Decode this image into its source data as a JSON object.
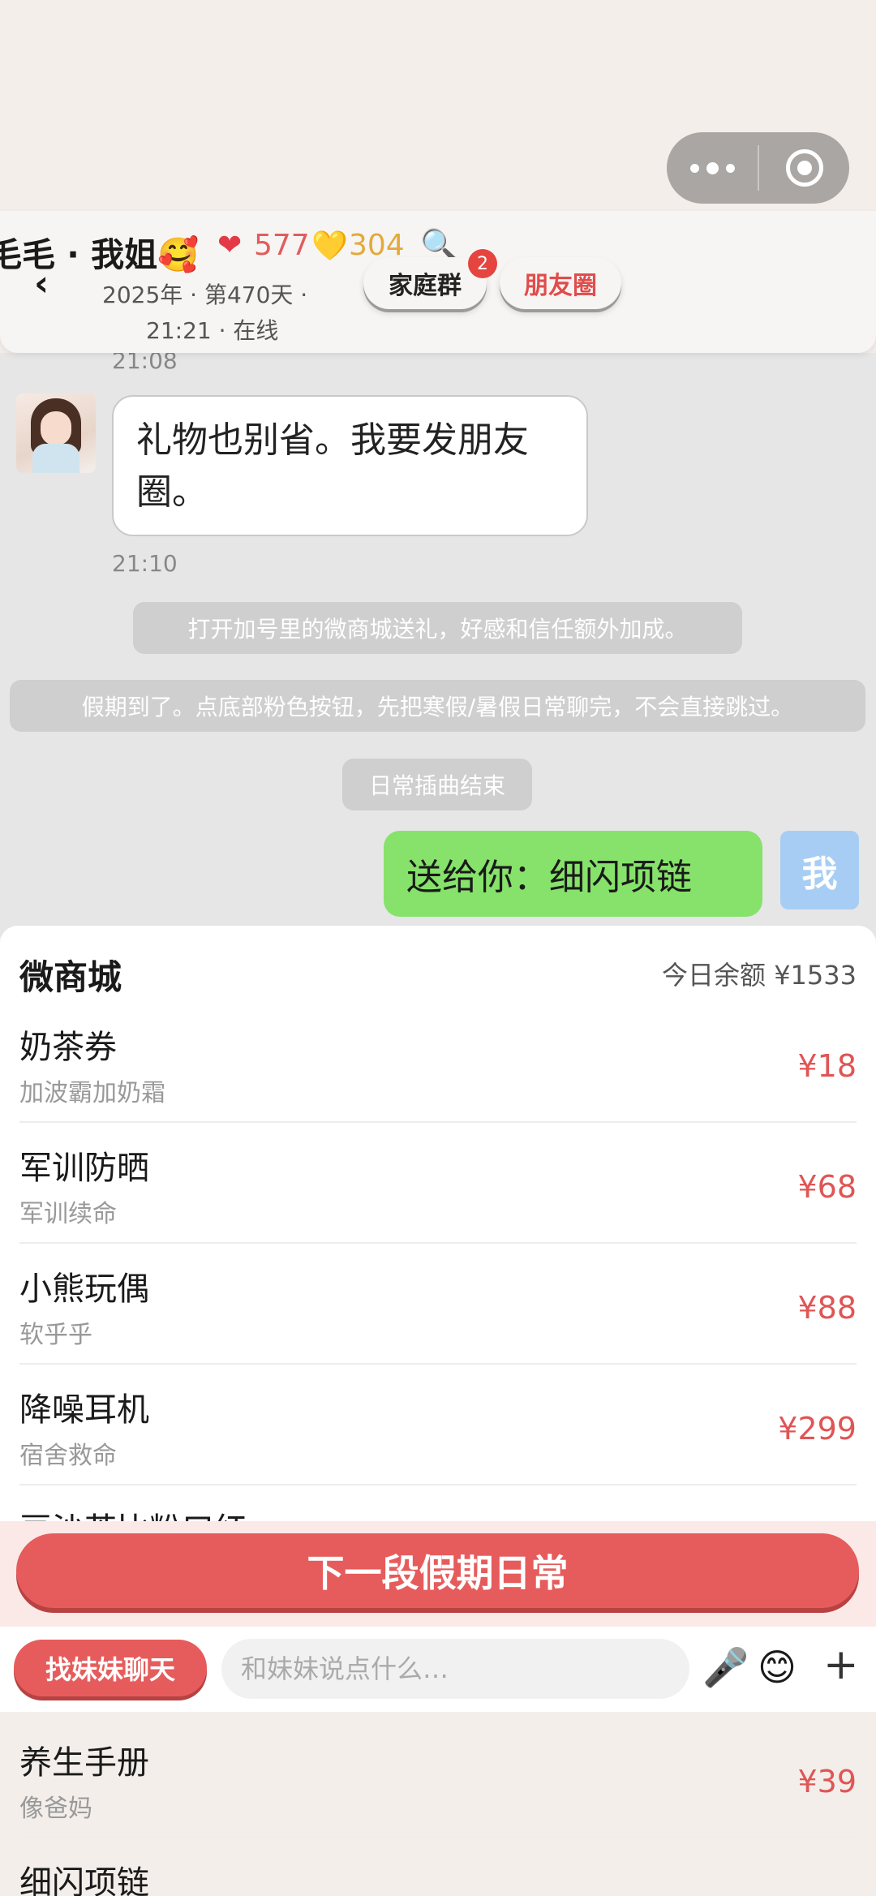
{
  "capsule": {
    "more_icon": "more-dots-icon",
    "close_icon": "target-close-icon"
  },
  "header": {
    "name": "毛毛 · 我姐🥰",
    "heart_red": "❤",
    "heart_red_value": "577",
    "heart_yellow": "💛",
    "heart_yellow_value": "304",
    "search_glyph": "🔍",
    "back_glyph": "‹",
    "subline1": "2025年 · 第470天 ·",
    "subline2": "21:21 · 在线",
    "tab_family": "家庭群",
    "tab_family_badge": "2",
    "tab_moments": "朋友圈"
  },
  "chat": {
    "time_top": "21:08",
    "message_left": "礼物也别省。我要发朋友圈。",
    "time_mid": "21:10",
    "system1": "打开加号里的微商城送礼，好感和信任额外加成。",
    "system2": "假期到了。点底部粉色按钮，先把寒假/暑假日常聊完，不会直接跳过。",
    "system3": "日常插曲结束",
    "message_right": "送给你：细闪项链",
    "me_label": "我"
  },
  "shop": {
    "title": "微商城",
    "balance": "今日余额 ¥1533",
    "items": [
      {
        "name": "奶茶券",
        "desc": "加波霸加奶霜",
        "price": "¥18"
      },
      {
        "name": "军训防晒",
        "desc": "军训续命",
        "price": "¥68"
      },
      {
        "name": "小熊玩偶",
        "desc": "软乎乎",
        "price": "¥88"
      },
      {
        "name": "降噪耳机",
        "desc": "宿舍救命",
        "price": "¥299"
      },
      {
        "name": "豆沙茶比粉口红",
        "desc": "",
        "price": ""
      }
    ]
  },
  "next_button": "下一段假期日常",
  "input_bar": {
    "chat_button": "找妹妹聊天",
    "placeholder": "和妹妹说点什么…",
    "mic_glyph": "🎤",
    "emoji_glyph": "😊",
    "plus_glyph": "+"
  },
  "lower_items": [
    {
      "name": "养生手册",
      "desc": "像爸妈",
      "price": "¥39"
    },
    {
      "name": "细闪项链",
      "desc": "",
      "price": ""
    }
  ]
}
